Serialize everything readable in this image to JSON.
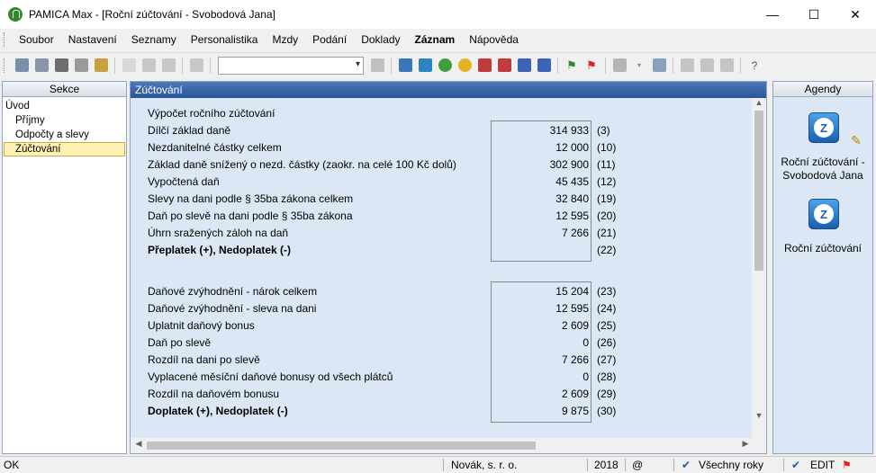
{
  "window": {
    "title": "PAMICA Max - [Roční zúčtování - Svobodová Jana]",
    "minimize": "—",
    "maximize": "☐",
    "close": "✕"
  },
  "menu": [
    {
      "label": "Soubor"
    },
    {
      "label": "Nastavení"
    },
    {
      "label": "Seznamy"
    },
    {
      "label": "Personalistika"
    },
    {
      "label": "Mzdy"
    },
    {
      "label": "Podání"
    },
    {
      "label": "Doklady"
    },
    {
      "label": "Záznam"
    },
    {
      "label": "Nápověda"
    }
  ],
  "toolbar": {
    "combo_value": ""
  },
  "sections": {
    "header": "Sekce",
    "items": [
      {
        "label": "Úvod"
      },
      {
        "label": "Příjmy"
      },
      {
        "label": "Odpočty a slevy"
      },
      {
        "label": "Zúčtování"
      }
    ]
  },
  "main": {
    "header": "Zúčtování",
    "section_title": "Výpočet ročního zúčtování",
    "group1": [
      {
        "label": "Dílčí základ daně",
        "value": "314 933",
        "code": "(3)"
      },
      {
        "label": "Nezdanitelné částky celkem",
        "value": "12 000",
        "code": "(10)"
      },
      {
        "label": "Základ daně snížený o nezd. částky (zaokr. na celé 100 Kč dolů)",
        "value": "302 900",
        "code": "(11)"
      },
      {
        "label": "Vypočtená daň",
        "value": "45 435",
        "code": "(12)"
      },
      {
        "label": "Slevy na dani podle § 35ba zákona celkem",
        "value": "32 840",
        "code": "(19)"
      },
      {
        "label": "Daň po slevě na dani podle § 35ba zákona",
        "value": "12 595",
        "code": "(20)"
      },
      {
        "label": "Úhrn sražených záloh na daň",
        "value": "7 266",
        "code": "(21)"
      },
      {
        "label": "Přeplatek (+), Nedoplatek (-)",
        "value": "",
        "code": "(22)"
      }
    ],
    "group2": [
      {
        "label": "Daňové zvýhodnění - nárok celkem",
        "value": "15 204",
        "code": "(23)"
      },
      {
        "label": "Daňové zvýhodnění - sleva na dani",
        "value": "12 595",
        "code": "(24)"
      },
      {
        "label": "Uplatnit daňový bonus",
        "value": "2 609",
        "code": "(25)"
      },
      {
        "label": "Daň po slevě",
        "value": "0",
        "code": "(26)"
      },
      {
        "label": "Rozdíl na dani po slevě",
        "value": "7 266",
        "code": "(27)"
      },
      {
        "label": "Vyplacené měsíční daňové bonusy od všech plátců",
        "value": "0",
        "code": "(28)"
      },
      {
        "label": "Rozdíl na daňovém bonusu",
        "value": "2 609",
        "code": "(29)"
      },
      {
        "label": "Doplatek (+), Nedoplatek (-)",
        "value": "9 875",
        "code": "(30)"
      }
    ]
  },
  "agendy": {
    "header": "Agendy",
    "items": [
      {
        "label1": "Roční zúčtování -",
        "label2": "Svobodová Jana",
        "icon_letter": "Z"
      },
      {
        "label1": "Roční zúčtování",
        "label2": "",
        "icon_letter": "Z"
      }
    ]
  },
  "status": {
    "left": "OK",
    "company": "Novák, s. r. o.",
    "year": "2018",
    "at": "@",
    "years": "Všechny roky",
    "mode": "EDIT"
  }
}
